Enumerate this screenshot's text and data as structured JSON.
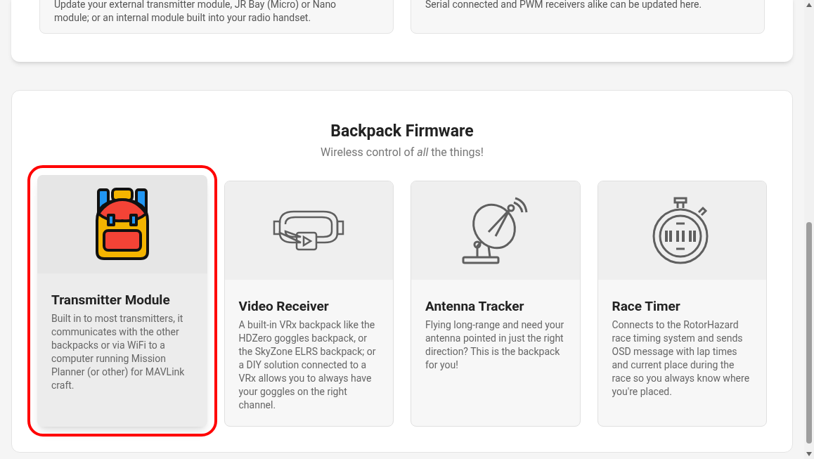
{
  "top_cards": [
    {
      "lines": [
        "Update your external transmitter module, JR Bay (Micro) or Nano",
        "module; or an internal module built into your radio handset."
      ]
    },
    {
      "lines": [
        "Serial connected and PWM receivers alike can be updated here."
      ]
    }
  ],
  "section": {
    "title": "Backpack Firmware",
    "subtitle": "Wireless control of *all* the things!",
    "cards": [
      {
        "kind": "backpack",
        "title": "Transmitter Module",
        "text": "Built in to most transmitters, it communicates with the other backpacks or via WiFi to a computer running Mission Planner (or other) for MAVLink craft.",
        "selected": true
      },
      {
        "kind": "goggles",
        "title": "Video Receiver",
        "text": "A built-in VRx backpack like the HDZero goggles backpack, or the SkyZone ELRS backpack; or a DIY solution connected to a VRx allows you to always have your goggles on the right channel.",
        "selected": false
      },
      {
        "kind": "dish",
        "title": "Antenna Tracker",
        "text": "Flying long-range and need your antenna pointed in just the right direction? This is the backpack for you!",
        "selected": false
      },
      {
        "kind": "stopwatch",
        "title": "Race Timer",
        "text": "Connects to the RotorHazard race timing system and sends OSD message with lap times and current place during the race so you always know where you're placed.",
        "selected": false
      }
    ]
  }
}
